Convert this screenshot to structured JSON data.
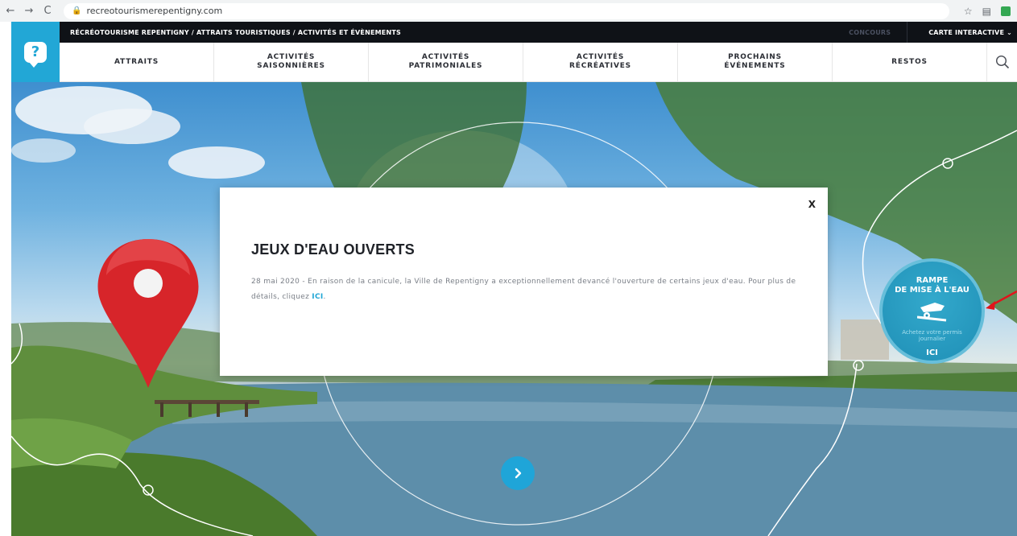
{
  "browser": {
    "url": "recreotourismerepentigny.com"
  },
  "site": {
    "logo_glyph": "?",
    "breadcrumb": "RÉCRÉOTOURISME REPENTIGNY / ATTRAITS TOURISTIQUES / ACTIVITÉS ET ÉVÈNEMENTS",
    "concours_label": "CONCOURS",
    "carte_label": "CARTE INTERACTIVE ⌄",
    "accent_color": "#22a7d6"
  },
  "nav": {
    "items": [
      {
        "label": "ATTRAITS"
      },
      {
        "label": "ACTIVITÉS\nSAISONNIÈRES"
      },
      {
        "label": "ACTIVITÉS\nPATRIMONIALES"
      },
      {
        "label": "ACTIVITÉS\nRÉCRÉATIVES"
      },
      {
        "label": "PROCHAINS\nÉVÉNEMENTS"
      },
      {
        "label": "RESTOS"
      }
    ]
  },
  "modal": {
    "close_label": "X",
    "title": "JEUX D'EAU OUVERTS",
    "text": "28 mai 2020 - En raison de la canicule, la Ville de Repentigny a exceptionnellement devancé l'ouverture de certains jeux d'eau. Pour plus de détails, cliquez ",
    "link_label": "ICI",
    "text_end": "."
  },
  "ramp_badge": {
    "title": "RAMPE\nDE MISE À L'EAU",
    "subtitle": "Achetez votre permis\njournalier",
    "cta": "ICI"
  }
}
